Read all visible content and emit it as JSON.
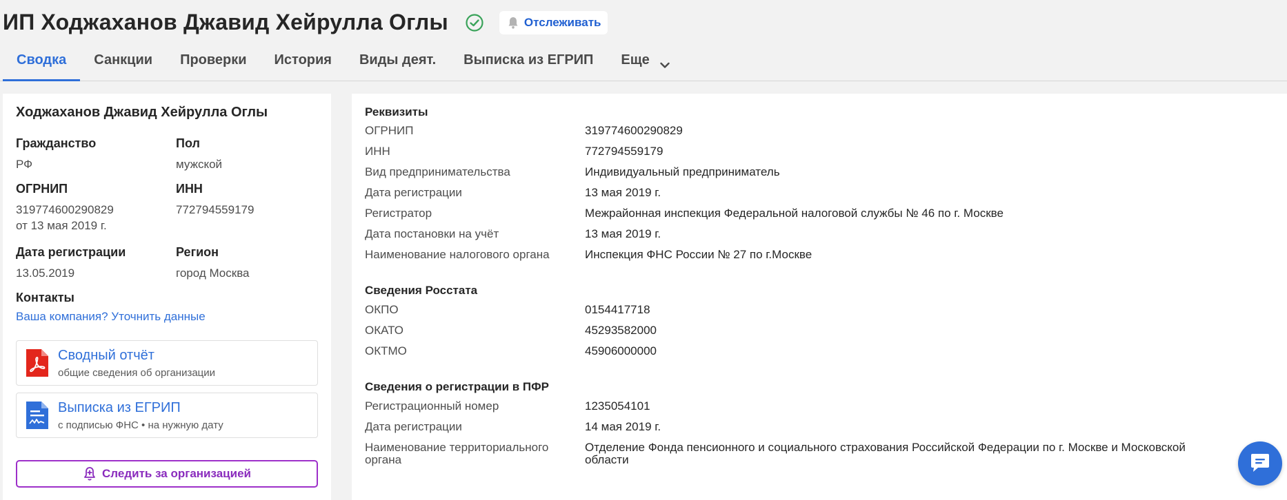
{
  "header": {
    "title": "ИП Ходжаханов Джавид Хейрулла Оглы",
    "track_label": "Отслеживать",
    "tabs": [
      {
        "label": "Сводка"
      },
      {
        "label": "Санкции"
      },
      {
        "label": "Проверки"
      },
      {
        "label": "История"
      },
      {
        "label": "Виды деят."
      },
      {
        "label": "Выписка из ЕГРИП"
      },
      {
        "label": "Еще"
      }
    ]
  },
  "left": {
    "name": "Ходжаханов Джавид Хейрулла Оглы",
    "citizenship_label": "Гражданство",
    "citizenship_value": "РФ",
    "sex_label": "Пол",
    "sex_value": "мужской",
    "ogrnip_label": "ОГРНИП",
    "ogrnip_value": "319774600290829",
    "ogrnip_date": "от 13 мая 2019 г.",
    "inn_label": "ИНН",
    "inn_value": "772794559179",
    "reg_date_label": "Дата регистрации",
    "reg_date_value": "13.05.2019",
    "region_label": "Регион",
    "region_value": "город Москва",
    "contacts_label": "Контакты",
    "contacts_link": "Ваша компания? Уточнить данные",
    "summary_report": {
      "title": "Сводный отчёт",
      "subtitle": "общие сведения об организации"
    },
    "egrip_extract": {
      "title": "Выписка из ЕГРИП",
      "subtitle": "с подписью ФНС • на нужную дату"
    },
    "follow_label": "Следить за организацией"
  },
  "requisites": {
    "title": "Реквизиты",
    "rows": [
      {
        "label": "ОГРНИП",
        "value": "319774600290829"
      },
      {
        "label": "ИНН",
        "value": "772794559179"
      },
      {
        "label": "Вид предпринимательства",
        "value": "Индивидуальный предприниматель"
      },
      {
        "label": "Дата регистрации",
        "value": "13 мая 2019 г."
      },
      {
        "label": "Регистратор",
        "value": "Межрайонная инспекция Федеральной налоговой службы № 46 по г. Москве"
      },
      {
        "label": "Дата постановки на учёт",
        "value": "13 мая 2019 г."
      },
      {
        "label": "Наименование налогового органа",
        "value": "Инспекция ФНС России № 27 по г.Москве"
      }
    ]
  },
  "rosstat": {
    "title": "Сведения Росстата",
    "rows": [
      {
        "label": "ОКПО",
        "value": "0154417718"
      },
      {
        "label": "ОКАТО",
        "value": "45293582000"
      },
      {
        "label": "ОКТМО",
        "value": "45906000000"
      }
    ]
  },
  "pfr": {
    "title": "Сведения о регистрации в ПФР",
    "rows": [
      {
        "label": "Регистрационный номер",
        "value": "1235054101"
      },
      {
        "label": "Дата регистрации",
        "value": "14 мая 2019 г."
      },
      {
        "label": "Наименование территориального",
        "label2": "органа",
        "value": "Отделение Фонда пенсионного и социального страхования Российской Федерации по г. Москве и Московской",
        "value2": "области"
      }
    ]
  },
  "colors": {
    "accent": "#2f6fd9",
    "follow": "#8a2bbd",
    "verified": "#3aa35a",
    "pdf": "#e3261c",
    "doc": "#2f6fd9"
  }
}
